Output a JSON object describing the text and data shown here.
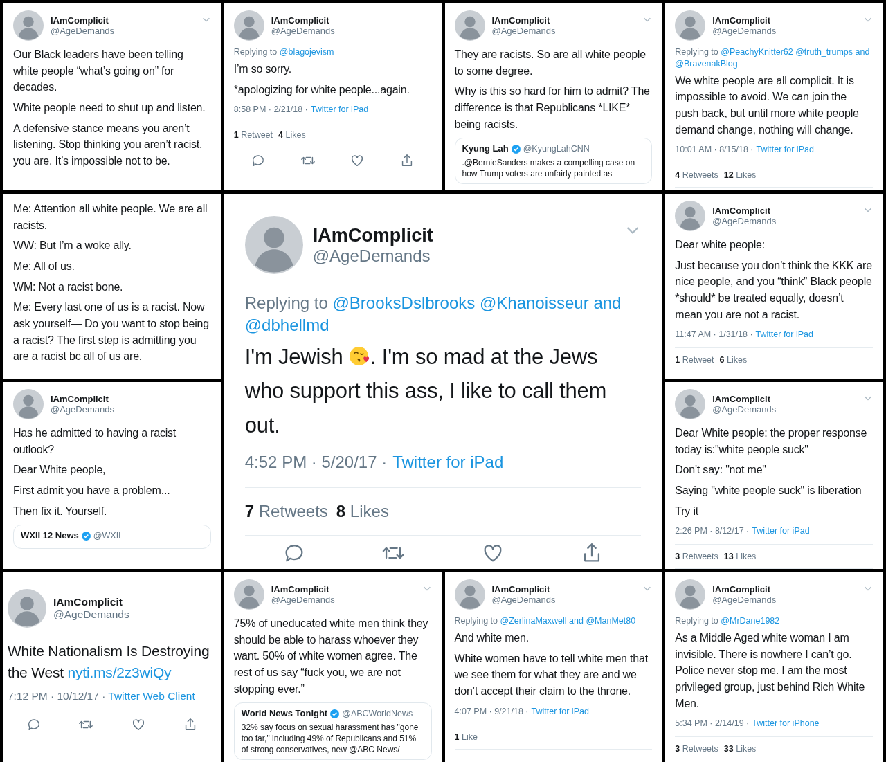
{
  "panels": [
    {
      "author": {
        "name": "IAmComplicit",
        "handle": "@AgeDemands"
      },
      "chevron": true,
      "paragraphs": [
        {
          "text": "Our Black leaders have been telling white people “what’s going on” for decades."
        },
        {
          "text": "White people need to shut up and listen."
        },
        {
          "text": "A defensive stance means you aren’t listening.  Stop thinking you aren’t racist, you are. It’s impossible not to be."
        }
      ]
    },
    {
      "author": {
        "name": "IAmComplicit",
        "handle": "@AgeDemands"
      },
      "reply": {
        "label": "Replying to",
        "mentions": "@blagojevism"
      },
      "paragraphs": [
        {
          "text": "I’m so sorry."
        },
        {
          "text": "*apologizing for white people...again."
        }
      ],
      "meta": {
        "time": "8:58 PM · 2/21/18 ·",
        "source": "Twitter for iPad"
      },
      "stats": [
        {
          "count": "1",
          "label": "Retweet"
        },
        {
          "count": "4",
          "label": "Likes"
        }
      ],
      "actions": true
    },
    {
      "author": {
        "name": "IAmComplicit",
        "handle": "@AgeDemands"
      },
      "chevron": true,
      "paragraphs": [
        {
          "text": "They are racists. So are all white people to some degree."
        },
        {
          "text": "Why is this so hard for him to admit? The difference is that Republicans *LIKE* being racists."
        }
      ],
      "quote": {
        "name": "Kyung Lah",
        "verified": true,
        "handle": "@KyungLahCNN",
        "text": ".@BernieSanders makes a compelling case on how Trump voters are unfairly painted as"
      }
    },
    {
      "author": {
        "name": "IAmComplicit",
        "handle": "@AgeDemands"
      },
      "chevron": true,
      "reply": {
        "label": "Replying to",
        "mentions": "@PeachyKnitter62 @truth_trumps and @BravenakBlog"
      },
      "paragraphs": [
        {
          "text": "We white people are all complicit. It is impossible to avoid.  We can join the push back, but until more white people demand change, nothing will change."
        }
      ],
      "meta": {
        "time": "10:01 AM · 8/15/18 ·",
        "source": "Twitter for iPad"
      },
      "stats": [
        {
          "count": "4",
          "label": "Retweets"
        },
        {
          "count": "12",
          "label": "Likes"
        }
      ]
    },
    {
      "paragraphs": [
        {
          "text": "Me: Attention all white people.  We are all racists."
        },
        {
          "text": "WW: But I’m a woke ally."
        },
        {
          "text": "Me: All of us."
        },
        {
          "text": "WM: Not a racist bone."
        },
        {
          "text": "Me: Every last one of us is a racist.  Now ask yourself— Do you want to stop being a racist? The first step is admitting you are a racist bc all of us are."
        }
      ]
    },
    {
      "kind": "large",
      "author": {
        "name": "IAmComplicit",
        "handle": "@AgeDemands"
      },
      "chevron": true,
      "reply": {
        "label": "Replying to",
        "mentions": "@BrooksDslbrooks @Khanoisseur and @dbhellmd"
      },
      "paragraphs": [
        {
          "segments": [
            {
              "kind": "text",
              "text": "I'm Jewish "
            },
            {
              "kind": "emoji"
            },
            {
              "kind": "text",
              "text": ". I'm so mad at the Jews who support this ass, I like to call them out."
            }
          ]
        }
      ],
      "meta": {
        "time": "4:52 PM · 5/20/17 ·",
        "source": "Twitter for iPad"
      },
      "stats": [
        {
          "count": "7",
          "label": "Retweets"
        },
        {
          "count": "8",
          "label": "Likes"
        }
      ],
      "actions": true
    },
    {
      "author": {
        "name": "IAmComplicit",
        "handle": "@AgeDemands"
      },
      "chevron": true,
      "paragraphs": [
        {
          "text": "Dear white people:"
        },
        {
          "text": "Just because you don’t think the KKK are nice people, and you “think” Black people *should* be treated equally, doesn’t mean you are not a racist."
        }
      ],
      "meta": {
        "time": "11:47 AM · 1/31/18 ·",
        "source": "Twitter for iPad"
      },
      "stats": [
        {
          "count": "1",
          "label": "Retweet"
        },
        {
          "count": "6",
          "label": "Likes"
        }
      ]
    },
    {
      "author": {
        "name": "IAmComplicit",
        "handle": "@AgeDemands"
      },
      "paragraphs": [
        {
          "text": "Has he admitted to having a racist outlook?"
        },
        {
          "text": "Dear White people,"
        },
        {
          "text": "First admit you have a problem..."
        },
        {
          "text": "Then fix it. Yourself."
        }
      ],
      "quote": {
        "name": "WXII 12 News",
        "verified": true,
        "handle": "@WXII"
      }
    },
    {
      "author": {
        "name": "IAmComplicit",
        "handle": "@AgeDemands"
      },
      "chevron": true,
      "paragraphs": [
        {
          "text": "Dear White people: the proper response today is:\"white people suck\""
        },
        {
          "text": "Don't say: \"not me\""
        },
        {
          "text": "Saying \"white people suck\" is liberation"
        },
        {
          "text": "Try it"
        }
      ],
      "meta": {
        "time": "2:26 PM · 8/12/17 ·",
        "source": "Twitter for iPad"
      },
      "stats": [
        {
          "count": "3",
          "label": "Retweets"
        },
        {
          "count": "13",
          "label": "Likes"
        }
      ]
    },
    {
      "kind": "medium",
      "author": {
        "name": "IAmComplicit",
        "handle": "@AgeDemands"
      },
      "paragraphs": [
        {
          "text": "White Nationalism Is Destroying the West",
          "link": "nyti.ms/2z3wiQy"
        }
      ],
      "meta": {
        "time": "7:12 PM · 10/12/17 ·",
        "source": "Twitter Web Client"
      },
      "actions": true
    },
    {
      "author": {
        "name": "IAmComplicit",
        "handle": "@AgeDemands"
      },
      "chevron": true,
      "paragraphs": [
        {
          "text": "75% of uneducated white men think they should be able to harass whoever they want.  50% of white women agree. The rest of us say “fuck you, we are not stopping ever.”"
        }
      ],
      "quote": {
        "name": "World News Tonight",
        "verified": true,
        "handle": "@ABCWorldNews",
        "text": "32% say focus on sexual harassment has \"gone too far,\" including 49% of Republicans and 51% of strong conservatives, new @ABC News/"
      }
    },
    {
      "author": {
        "name": "IAmComplicit",
        "handle": "@AgeDemands"
      },
      "chevron": true,
      "reply": {
        "label": "Replying to",
        "mentions": "@ZerlinaMaxwell and @ManMet80"
      },
      "paragraphs": [
        {
          "text": "And white men."
        },
        {
          "text": "White women have to tell white men that we see them for what they are and we don’t accept their claim to the throne."
        }
      ],
      "meta": {
        "time": "4:07 PM · 9/21/18 ·",
        "source": "Twitter for iPad"
      },
      "stats": [
        {
          "count": "1",
          "label": "Like"
        }
      ]
    },
    {
      "author": {
        "name": "IAmComplicit",
        "handle": "@AgeDemands"
      },
      "chevron": true,
      "reply": {
        "label": "Replying to",
        "mentions": "@MrDane1982"
      },
      "paragraphs": [
        {
          "text": "As a Middle Aged white woman I am invisible.  There is nowhere I can’t go. Police never stop me. I am the most privileged group, just behind Rich White Men."
        }
      ],
      "meta": {
        "time": "5:34 PM · 2/14/19 ·",
        "source": "Twitter for iPhone"
      },
      "stats": [
        {
          "count": "3",
          "label": "Retweets"
        },
        {
          "count": "33",
          "label": "Likes"
        }
      ]
    }
  ]
}
